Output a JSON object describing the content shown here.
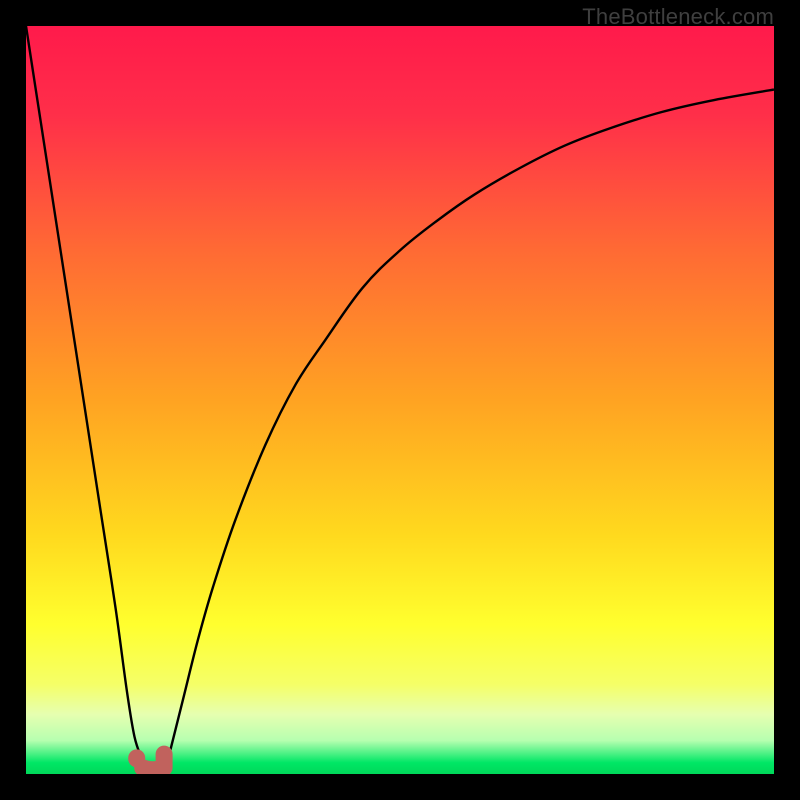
{
  "watermark": "TheBottleneck.com",
  "colors": {
    "frame": "#000000",
    "gradient_stops": [
      {
        "offset": 0.0,
        "color": "#ff1a4b"
      },
      {
        "offset": 0.12,
        "color": "#ff2f49"
      },
      {
        "offset": 0.3,
        "color": "#ff6a34"
      },
      {
        "offset": 0.5,
        "color": "#ffa322"
      },
      {
        "offset": 0.68,
        "color": "#ffd91e"
      },
      {
        "offset": 0.8,
        "color": "#ffff2e"
      },
      {
        "offset": 0.88,
        "color": "#f5ff67"
      },
      {
        "offset": 0.92,
        "color": "#e6ffb0"
      },
      {
        "offset": 0.955,
        "color": "#b7ffb0"
      },
      {
        "offset": 0.985,
        "color": "#00e765"
      },
      {
        "offset": 1.0,
        "color": "#00d85a"
      }
    ],
    "curve_stroke": "#000000",
    "marker_fill": "#c1625d",
    "marker_stroke": "#c1625d"
  },
  "chart_data": {
    "type": "line",
    "title": "",
    "xlabel": "",
    "ylabel": "",
    "xlim": [
      0,
      100
    ],
    "ylim": [
      0,
      100
    ],
    "grid": false,
    "legend": false,
    "series": [
      {
        "name": "left-branch",
        "x": [
          0,
          2,
          4,
          6,
          8,
          10,
          12,
          13.5,
          14.5,
          15.5
        ],
        "y": [
          100,
          87,
          74,
          61,
          48,
          35,
          22,
          11,
          5,
          2
        ]
      },
      {
        "name": "right-branch",
        "x": [
          19,
          21,
          23,
          25,
          28,
          32,
          36,
          40,
          45,
          50,
          55,
          60,
          66,
          72,
          78,
          85,
          92,
          100
        ],
        "y": [
          2,
          10,
          18,
          25,
          34,
          44,
          52,
          58,
          65,
          70,
          74,
          77.5,
          81,
          84,
          86.3,
          88.5,
          90.1,
          91.5
        ]
      }
    ],
    "markers": {
      "name": "optimal-band",
      "shape": "j-blob",
      "x_range": [
        14.8,
        19.0
      ],
      "y_range": [
        0.3,
        3.2
      ]
    },
    "annotations": []
  }
}
